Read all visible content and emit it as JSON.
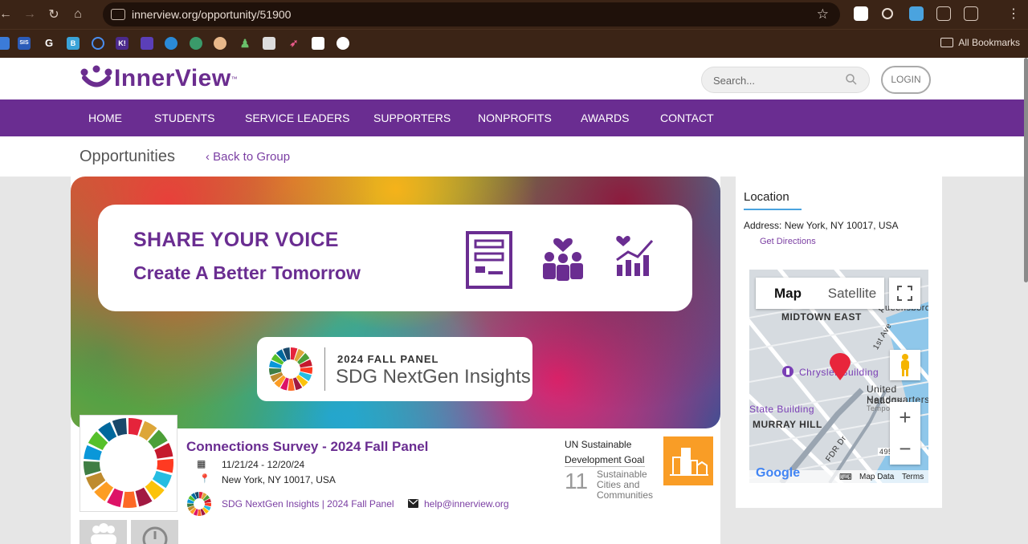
{
  "browser": {
    "url": "innerview.org/opportunity/51900",
    "all_bookmarks": "All Bookmarks",
    "bookmark_labels": [
      "SIS",
      "G",
      "B",
      "K!"
    ]
  },
  "header": {
    "logo_text": "InnerView",
    "logo_tm": "™",
    "search_placeholder": "Search...",
    "login_label": "LOGIN"
  },
  "nav": {
    "items": [
      "HOME",
      "STUDENTS",
      "SERVICE LEADERS",
      "SUPPORTERS",
      "NONPROFITS",
      "AWARDS",
      "CONTACT"
    ]
  },
  "subbar": {
    "title": "Opportunities",
    "back_label": "‹ Back to Group"
  },
  "banner": {
    "headline1": "SHARE YOUR VOICE",
    "headline2": "Create A Better Tomorrow",
    "panel_line1": "2024 FALL PANEL",
    "panel_line2": "SDG NextGen Insights"
  },
  "opportunity": {
    "title": "Connections Survey - 2024 Fall Panel",
    "dates": "11/21/24 - 12/20/24",
    "location": "New York, NY 10017, USA",
    "group_link": "SDG NextGen Insights | 2024 Fall Panel",
    "email": "help@innerview.org",
    "sdg_label_1": "UN Sustainable",
    "sdg_label_2": "Development Goal",
    "sdg_number": "11",
    "sdg_name_1": "Sustainable",
    "sdg_name_2": "Cities and",
    "sdg_name_3": "Communities"
  },
  "sidebar": {
    "location_title": "Location",
    "address": "Address: New York, NY 10017, USA",
    "directions": "Get Directions"
  },
  "map": {
    "tab_map": "Map",
    "tab_satellite": "Satellite",
    "labels": {
      "midtown_east": "MIDTOWN EAST",
      "queensboro": "Queensboro",
      "chrysler": "Chrysler Building",
      "un_hq_1": "United Nations",
      "un_hq_2": "Headquarters",
      "temp": "Tempo",
      "state_building": "State Building",
      "murray_hill": "MURRAY HILL",
      "first_ave": "1st Ave",
      "fdr": "FDR Dr",
      "route": "495"
    },
    "google": "Google",
    "map_data": "Map Data",
    "terms": "Terms"
  },
  "colors": {
    "brand_purple": "#6a2d91",
    "sdg11_orange": "#f99d26",
    "pin_red": "#e8253b"
  }
}
